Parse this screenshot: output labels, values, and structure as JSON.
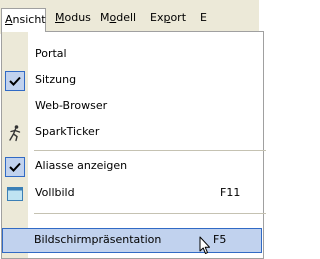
{
  "menubar": {
    "items": [
      {
        "pre": "",
        "u": "A",
        "post": "nsicht"
      },
      {
        "pre": "",
        "u": "M",
        "post": "odus"
      },
      {
        "pre": "M",
        "u": "o",
        "post": "dell"
      },
      {
        "pre": "Ex",
        "u": "p",
        "post": "ort"
      },
      {
        "pre": "E",
        "u": "",
        "post": ""
      }
    ]
  },
  "menu": {
    "items": [
      {
        "label": "Portal",
        "checked": false
      },
      {
        "label": "Sitzung",
        "checked": true
      },
      {
        "label": "Web-Browser",
        "checked": false
      },
      {
        "label": "SparkTicker",
        "icon": "sparkticker-runner-icon"
      },
      {
        "label": "Aliasse anzeigen",
        "checked": true
      },
      {
        "label": "Vollbild",
        "shortcut": "F11",
        "icon": "fullscreen-window-icon"
      },
      {
        "label": "Bildschirmpräsentation",
        "shortcut": "F5",
        "highlighted": true
      }
    ]
  },
  "colors": {
    "menubar_bg": "#ece9d8",
    "highlight_bg": "#c1d2ee",
    "highlight_border": "#316ac5"
  }
}
